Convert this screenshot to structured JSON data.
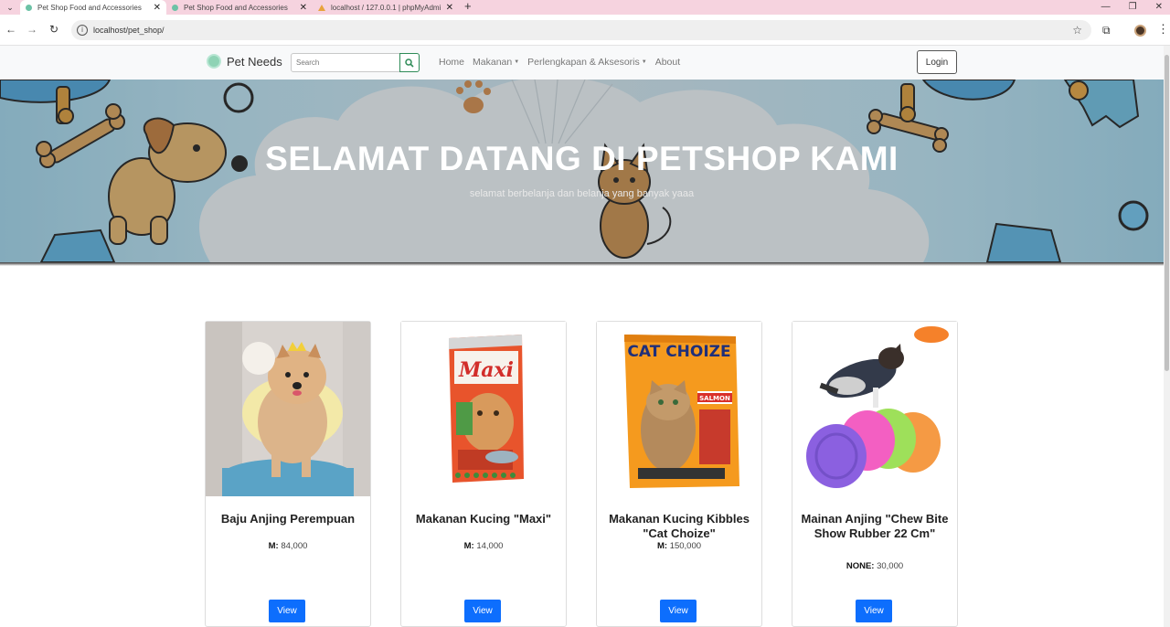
{
  "browser": {
    "tabs": [
      {
        "title": "Pet Shop Food and Accessories",
        "active": true
      },
      {
        "title": "Pet Shop Food and Accessories",
        "active": false
      },
      {
        "title": "localhost / 127.0.0.1 | phpMyAdmin",
        "active": false
      }
    ],
    "url": "localhost/pet_shop/"
  },
  "navbar": {
    "brand": "Pet Needs",
    "search_placeholder": "Search",
    "links": [
      {
        "label": "Home",
        "dropdown": false
      },
      {
        "label": "Makanan",
        "dropdown": true
      },
      {
        "label": "Perlengkapan & Aksesoris",
        "dropdown": true
      },
      {
        "label": "About",
        "dropdown": false
      }
    ],
    "login_label": "Login"
  },
  "hero": {
    "title": "SELAMAT DATANG DI PETSHOP KAMI",
    "subtitle": "selamat berbelanja dan belanja yang banyak yaaa"
  },
  "products": [
    {
      "name": "Baju Anjing Perempuan",
      "price_label": "M:",
      "price": "84,000",
      "button": "View"
    },
    {
      "name": "Makanan Kucing \"Maxi\"",
      "price_label": "M:",
      "price": "14,000",
      "button": "View"
    },
    {
      "name": "Makanan Kucing Kibbles \"Cat Choize\"",
      "price_label": "M:",
      "price": "150,000",
      "button": "View"
    },
    {
      "name": "Mainan Anjing \"Chew Bite Show Rubber 22 Cm\"",
      "price_label": "NONE:",
      "price": "30,000",
      "button": "View"
    }
  ],
  "product_images": {
    "maxi_brand": "Maxi",
    "catchoize_brand": "CAT CHOIZE",
    "catchoize_variant": "SALMON"
  },
  "colors": {
    "primary_button": "#0d6efd",
    "tab_bar": "#f6d3df",
    "navbar_bg": "#f8f9fa"
  }
}
